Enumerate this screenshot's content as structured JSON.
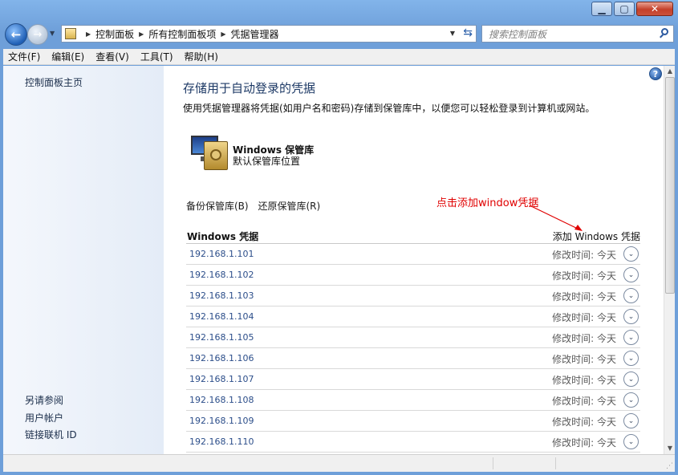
{
  "window": {
    "minimize_icon": "minimize-icon",
    "maximize_icon": "maximize-icon",
    "close_icon": "close-icon"
  },
  "address_bar": {
    "crumbs": [
      "控制面板",
      "所有控制面板项",
      "凭据管理器"
    ],
    "search_placeholder": "搜索控制面板"
  },
  "menu": [
    "文件(F)",
    "编辑(E)",
    "查看(V)",
    "工具(T)",
    "帮助(H)"
  ],
  "sidebar": {
    "home": "控制面板主页",
    "see_also_title": "另请参阅",
    "links": [
      "用户帐户",
      "链接联机 ID"
    ]
  },
  "main": {
    "title": "存储用于自动登录的凭据",
    "description": "使用凭据管理器将凭据(如用户名和密码)存储到保管库中，以便您可以轻松登录到计算机或网站。",
    "vault": {
      "name": "Windows 保管库",
      "subtitle": "默认保管库位置"
    },
    "backup_link": "备份保管库(B)",
    "restore_link": "还原保管库(R)",
    "annotation": "点击添加window凭据",
    "section_title": "Windows 凭据",
    "add_link": "添加 Windows 凭据",
    "credentials": [
      {
        "name": "192.168.1.101",
        "modified": "修改时间: 今天"
      },
      {
        "name": "192.168.1.102",
        "modified": "修改时间: 今天"
      },
      {
        "name": "192.168.1.103",
        "modified": "修改时间: 今天"
      },
      {
        "name": "192.168.1.104",
        "modified": "修改时间: 今天"
      },
      {
        "name": "192.168.1.105",
        "modified": "修改时间: 今天"
      },
      {
        "name": "192.168.1.106",
        "modified": "修改时间: 今天"
      },
      {
        "name": "192.168.1.107",
        "modified": "修改时间: 今天"
      },
      {
        "name": "192.168.1.108",
        "modified": "修改时间: 今天"
      },
      {
        "name": "192.168.1.109",
        "modified": "修改时间: 今天"
      },
      {
        "name": "192.168.1.110",
        "modified": "修改时间: 今天"
      }
    ]
  },
  "colors": {
    "annotation": "#e00000",
    "link": "#2c4e8a",
    "title": "#1e3a66"
  }
}
